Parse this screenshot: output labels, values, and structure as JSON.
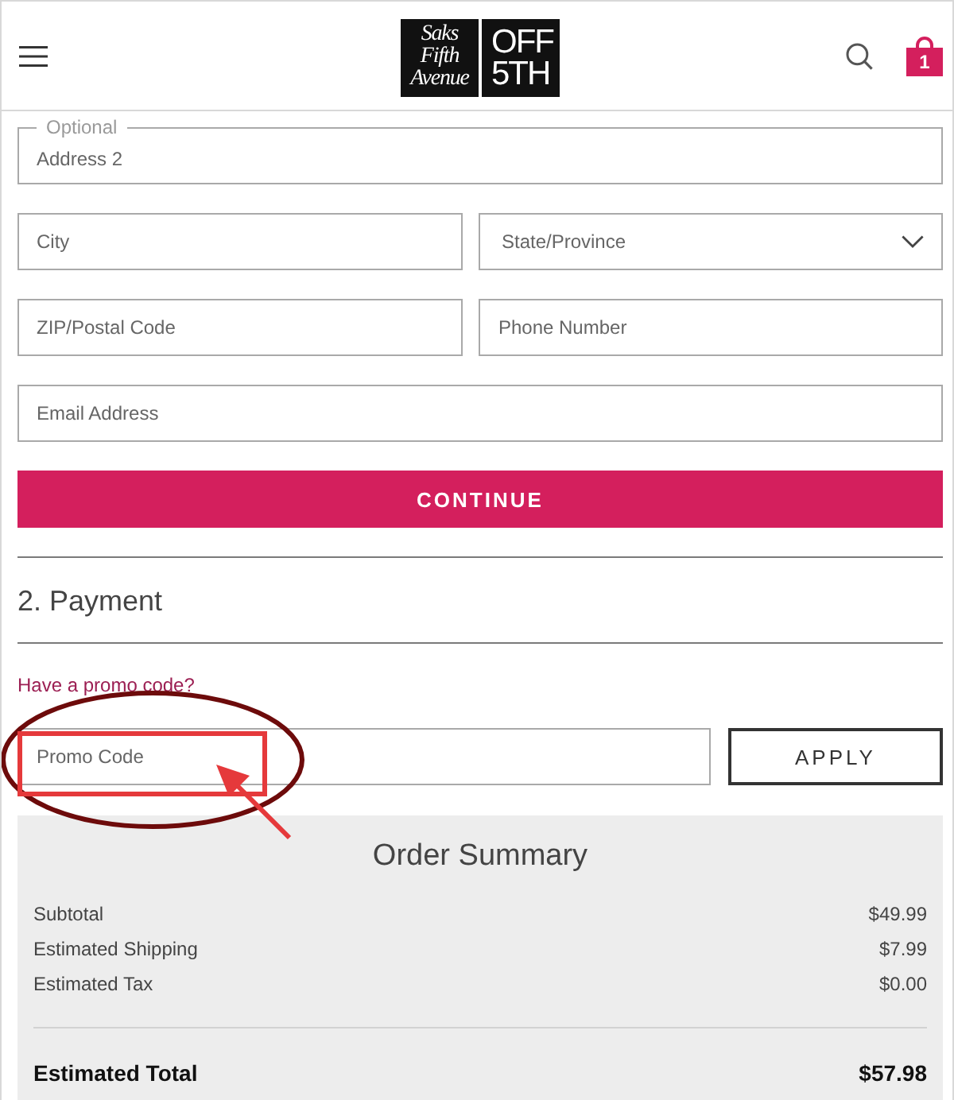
{
  "header": {
    "logo": {
      "script_lines": [
        "Saks",
        "Fifth",
        "Avenue"
      ],
      "block_lines": [
        "OFF",
        "5TH"
      ]
    },
    "cart_count": "1"
  },
  "shipping_form": {
    "rows": [
      [
        {
          "kind": "input",
          "label": "Optional",
          "placeholder": "Address 2"
        }
      ],
      [
        {
          "kind": "input",
          "placeholder": "City"
        },
        {
          "kind": "select",
          "placeholder": "State/Province"
        }
      ],
      [
        {
          "kind": "input",
          "placeholder": "ZIP/Postal Code"
        },
        {
          "kind": "input",
          "placeholder": "Phone Number"
        }
      ],
      [
        {
          "kind": "input",
          "placeholder": "Email Address"
        }
      ]
    ],
    "submit_button": "CONTINUE"
  },
  "payment": {
    "heading": "2. Payment",
    "promo_link": "Have a promo code?",
    "promo_field": {
      "placeholder": "Promo Code"
    },
    "apply_button": "APPLY"
  },
  "order_summary": {
    "title": "Order Summary",
    "lines": [
      {
        "label": "Subtotal",
        "value": "$49.99"
      },
      {
        "label": "Estimated Shipping",
        "value": "$7.99"
      },
      {
        "label": "Estimated Tax",
        "value": "$0.00"
      }
    ],
    "total": {
      "label": "Estimated Total",
      "value": "$57.98"
    }
  },
  "annotations": [
    {
      "kind": "ellipse"
    },
    {
      "kind": "rectangle"
    },
    {
      "kind": "arrow"
    }
  ]
}
